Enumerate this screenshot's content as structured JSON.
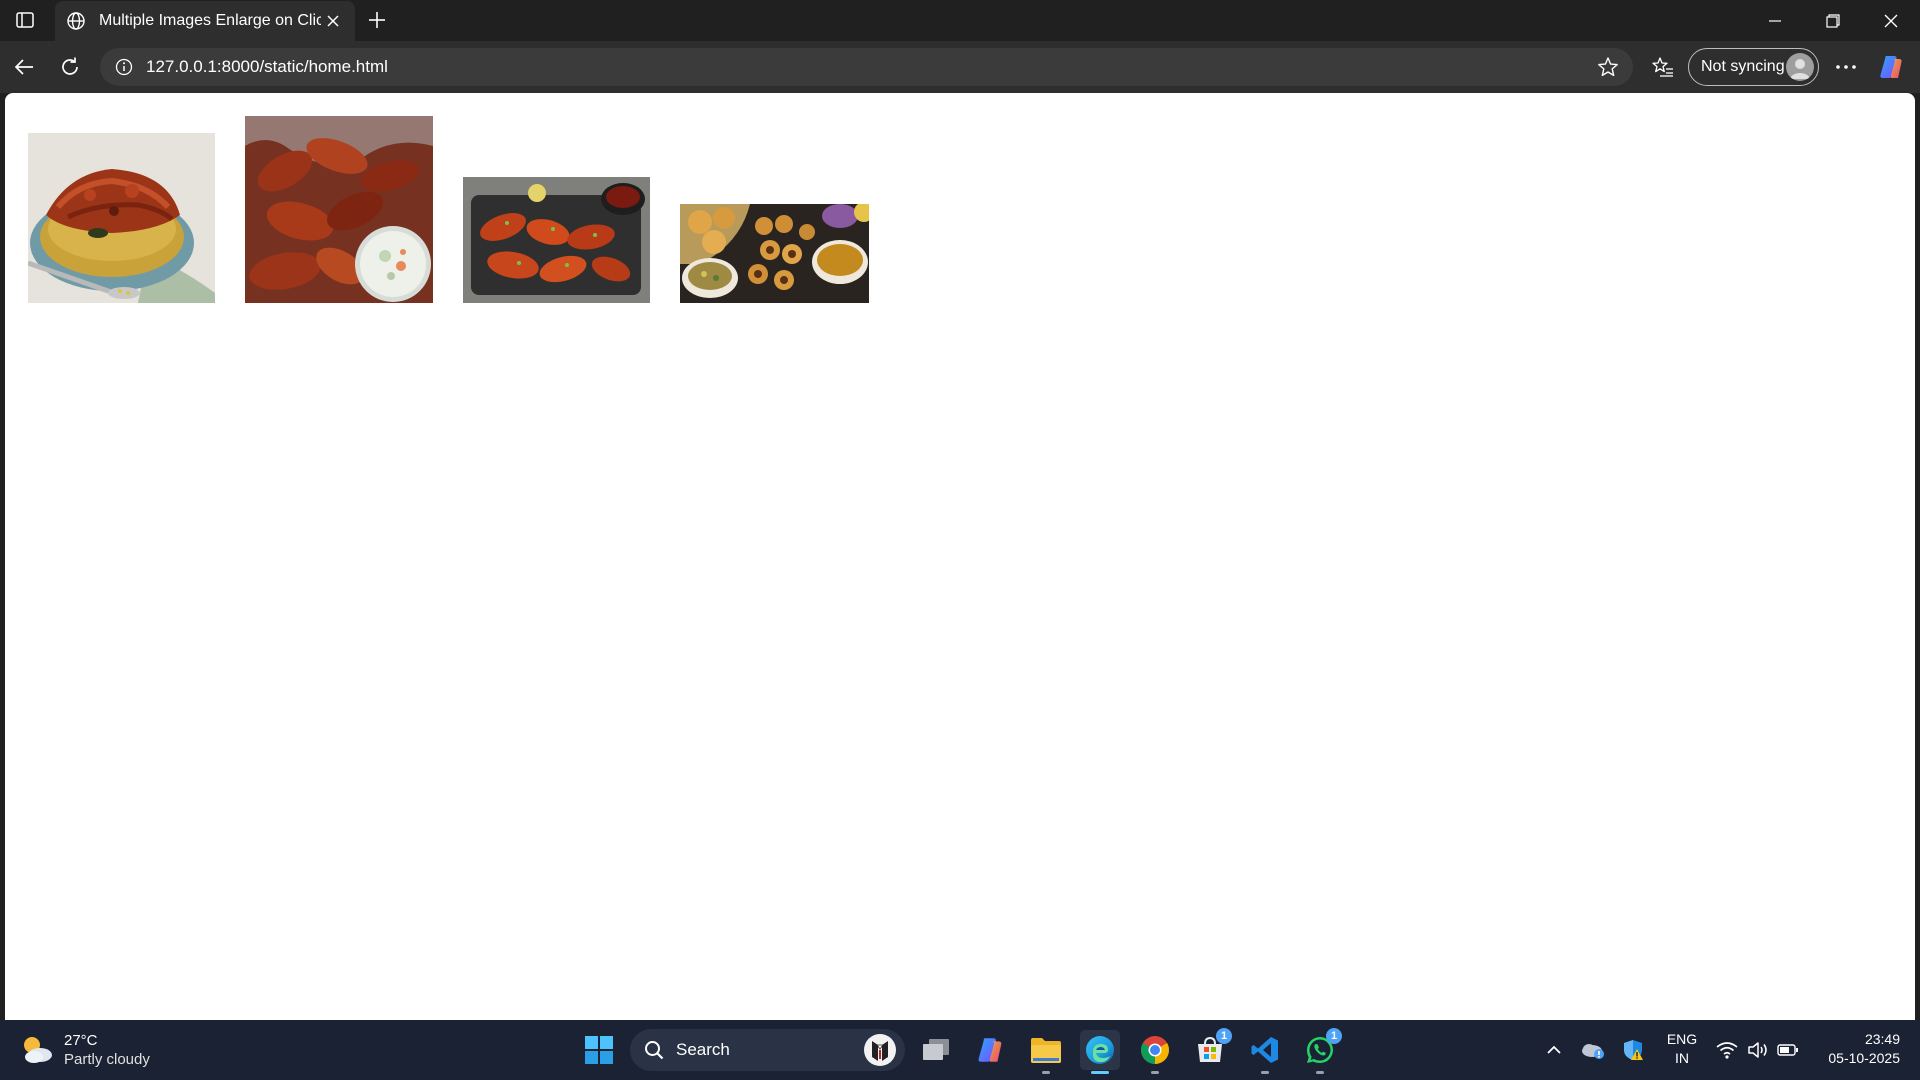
{
  "browser": {
    "tab": {
      "title": "Multiple Images Enlarge on Click"
    },
    "address": {
      "url": "127.0.0.1:8000/static/home.html"
    },
    "profile": {
      "sync_label": "Not syncing"
    }
  },
  "page": {
    "images": [
      {
        "name": "food-image-1",
        "subject": "pulao-with-chicken-on-plate"
      },
      {
        "name": "food-image-2",
        "subject": "chicken-wings-with-slaw"
      },
      {
        "name": "food-image-3",
        "subject": "chicken-wings-on-tray"
      },
      {
        "name": "food-image-4",
        "subject": "pani-puri-platter"
      }
    ]
  },
  "taskbar": {
    "weather": {
      "temp": "27°C",
      "desc": "Partly cloudy"
    },
    "search": {
      "label": "Search"
    },
    "badges": {
      "store": "1",
      "whatsapp": "1"
    },
    "language": {
      "line1": "ENG",
      "line2": "IN"
    },
    "clock": {
      "time": "23:49",
      "date": "05-10-2025"
    }
  },
  "colors": {
    "chrome_bg": "#202020",
    "toolbar_bg": "#2e2e2e",
    "address_bg": "#3b3b3b",
    "taskbar_bg": "#1b2233",
    "edge_accent": "#60cdff"
  }
}
